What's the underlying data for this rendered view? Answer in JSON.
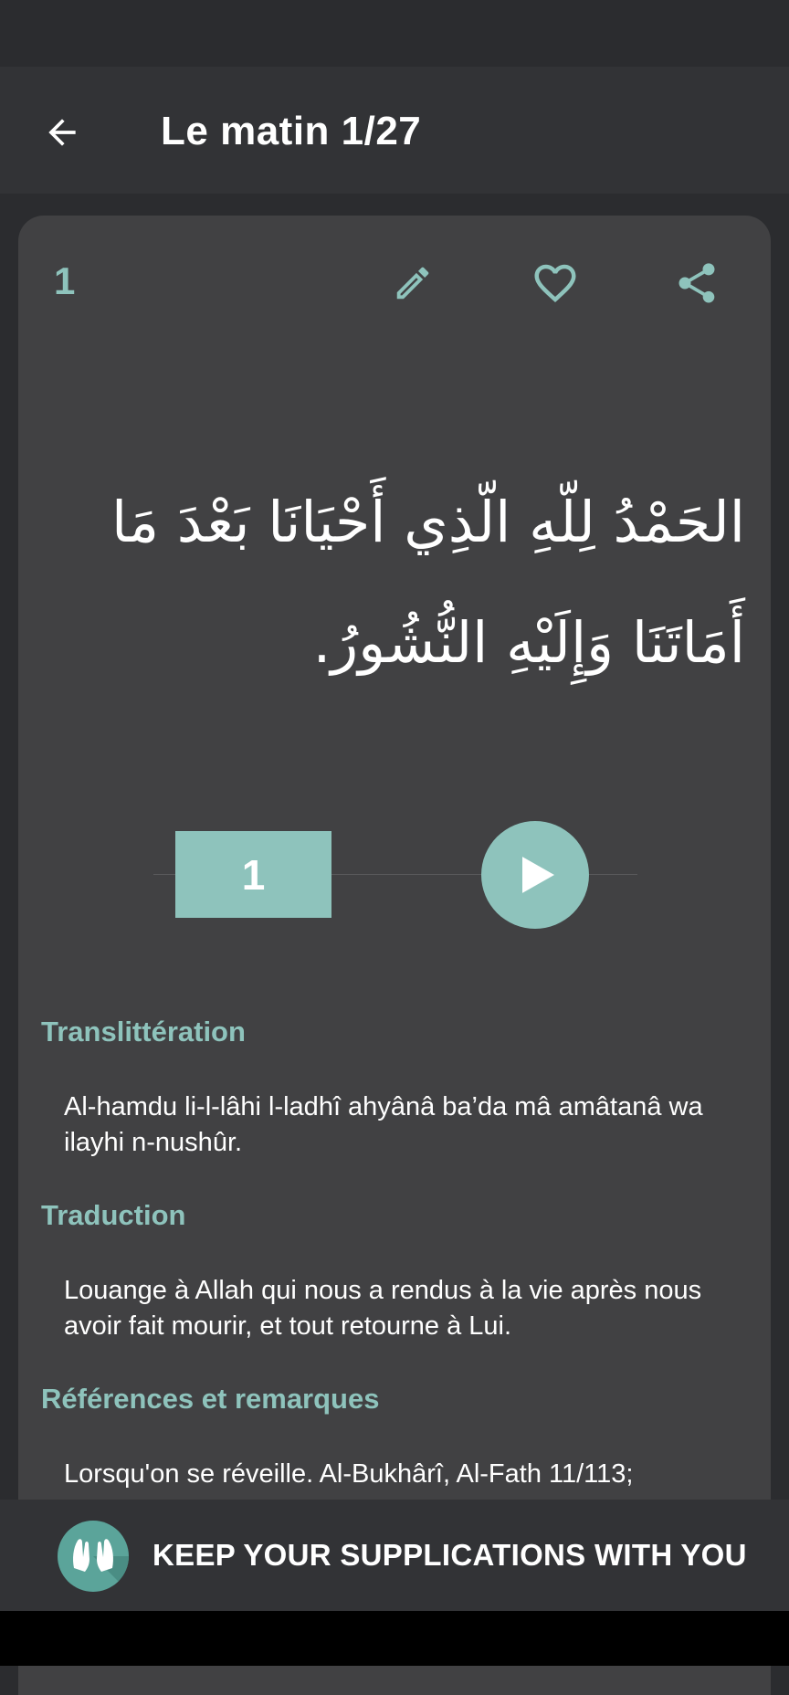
{
  "app_bar": {
    "title": "Le matin 1/27",
    "back_icon": "arrow-back-icon"
  },
  "card": {
    "number": "1",
    "actions": {
      "edit_icon": "pencil-icon",
      "favorite_icon": "heart-outline-icon",
      "share_icon": "share-icon"
    },
    "arabic_text": "الحَمْدُ لِلّهِ الّذِي أَحْيَانَا بَعْدَ مَا أَمَاتَنَا وَإِلَيْهِ النُّشُورُ.",
    "counter": "1",
    "play_icon": "play-icon",
    "sections": {
      "transliteration": {
        "title": "Translittération",
        "body": "Al-hamdu li-l-lâhi l-ladhî ahyânâ ba’da mâ amâtanâ wa ilayhi n-nushûr."
      },
      "translation": {
        "title": "Traduction",
        "body": "Louange à Allah qui nous a rendus à la vie après nous avoir fait mourir, et tout retourne à Lui."
      },
      "references": {
        "title": "Références et remarques",
        "body": "Lorsqu'on se réveille. Al-Bukhârî, Al-Fath 11/113;"
      }
    }
  },
  "banner": {
    "text": "KEEP YOUR SUPPLICATIONS WITH YOU",
    "logo_icon": "praying-hands-icon"
  },
  "colors": {
    "accent": "#8ec3bc",
    "card": "#414143",
    "background": "#2b2c2f",
    "app_bar": "#323336"
  }
}
